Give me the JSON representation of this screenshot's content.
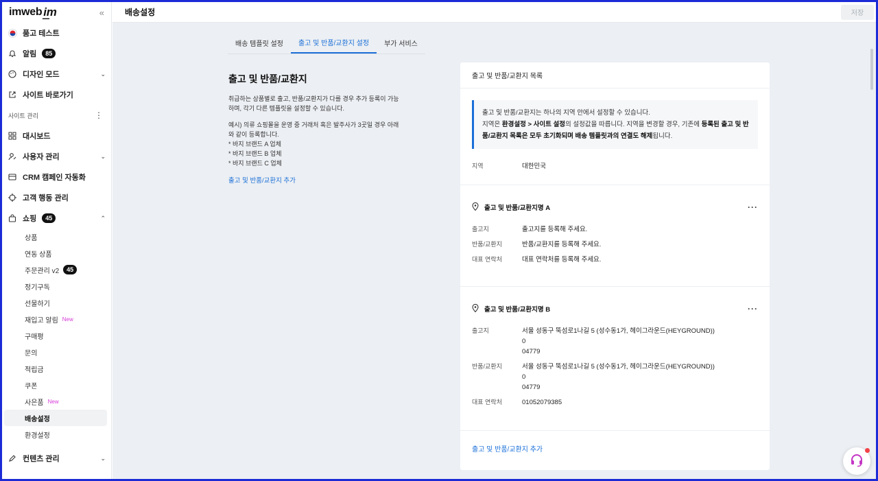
{
  "sidebar": {
    "logo": "imweb",
    "top_items": [
      {
        "icon": "korea-flag-icon",
        "label": "품고 테스트"
      },
      {
        "icon": "bell-icon",
        "label": "알림",
        "badge": "85"
      },
      {
        "icon": "palette-icon",
        "label": "디자인 모드"
      },
      {
        "icon": "external-link-icon",
        "label": "사이트 바로가기"
      }
    ],
    "section_label": "사이트 관리",
    "main_items": [
      {
        "icon": "dashboard-icon",
        "label": "대시보드"
      },
      {
        "icon": "user-icon",
        "label": "사용자 관리"
      },
      {
        "icon": "campaign-icon",
        "label": "CRM 캠페인 자동화"
      },
      {
        "icon": "target-icon",
        "label": "고객 행동 관리"
      }
    ],
    "shopping": {
      "label": "쇼핑",
      "badge": "45"
    },
    "shopping_sub": [
      {
        "label": "상품"
      },
      {
        "label": "연동 상품"
      },
      {
        "label": "주문관리 v2",
        "badge": "45"
      },
      {
        "label": "정기구독"
      },
      {
        "label": "선물하기"
      },
      {
        "label": "재입고 알림",
        "tag": "New"
      },
      {
        "label": "구매평"
      },
      {
        "label": "문의"
      },
      {
        "label": "적립금"
      },
      {
        "label": "쿠폰"
      },
      {
        "label": "사은품",
        "tag": "New"
      },
      {
        "label": "배송설정",
        "active": true
      },
      {
        "label": "환경설정"
      }
    ],
    "contents": {
      "label": "컨텐츠 관리"
    }
  },
  "header": {
    "title": "배송설정",
    "save": "저장"
  },
  "tabs": [
    {
      "label": "배송 템플릿 설정",
      "active": false
    },
    {
      "label": "출고 및 반품/교환지 설정",
      "active": true
    },
    {
      "label": "부가 서비스",
      "active": false
    }
  ],
  "left": {
    "title": "출고 및 반품/교환지",
    "desc": "취급하는 상품별로 출고, 반품/교환지가 다를 경우 추가 등록이 가능하며, 각기 다른 템플릿을 설정할 수 있습니다.",
    "example_lines": [
      "예시) 의류 쇼핑몰을 운영 중 거래처 혹은 발주사가 3곳일 경우 아래와 같이 등록합니다.",
      "* 바지 브랜드 A 업체",
      "* 바지 브랜드 B 업체",
      "* 바지 브랜드 C 업체"
    ],
    "add_link": "출고 및 반품/교환지 추가"
  },
  "card": {
    "title": "출고 및 반품/교환지 목록",
    "info": {
      "line1": "출고 및 반품/교환지는 하나의 지역 안에서 설정할 수 있습니다.",
      "line2a": "지역은 ",
      "line2b": "환경설정 > 사이트 설정",
      "line2c": "의 설정값을 따릅니다. 지역을 변경할 경우, 기존에 ",
      "line2d": "등록된 출고 및 반품/교환지 목록은 모두 초기화되며 배송 템플릿과의 연결도 해제",
      "line2e": "됩니다."
    },
    "region_key": "지역",
    "region_val": "대한민국",
    "locations": [
      {
        "name": "출고 및 반품/교환지명 A",
        "rows": [
          {
            "key": "출고지",
            "val": "출고지를 등록해 주세요."
          },
          {
            "key": "반품/교환지",
            "val": "반품/교환지를 등록해 주세요."
          },
          {
            "key": "대표 연락처",
            "val": "대표 연락처를 등록해 주세요."
          }
        ]
      },
      {
        "name": "출고 및 반품/교환지명 B",
        "rows": [
          {
            "key": "출고지",
            "val": "서울 성동구 뚝섬로1나길 5 (성수동1가, 헤이그라운드(HEYGROUND))\n0\n04779"
          },
          {
            "key": "반품/교환지",
            "val": "서울 성동구 뚝섬로1나길 5 (성수동1가, 헤이그라운드(HEYGROUND))\n0\n04779"
          },
          {
            "key": "대표 연락처",
            "val": "01052079385"
          }
        ]
      }
    ],
    "add_link": "출고 및 반품/교환지 추가"
  }
}
